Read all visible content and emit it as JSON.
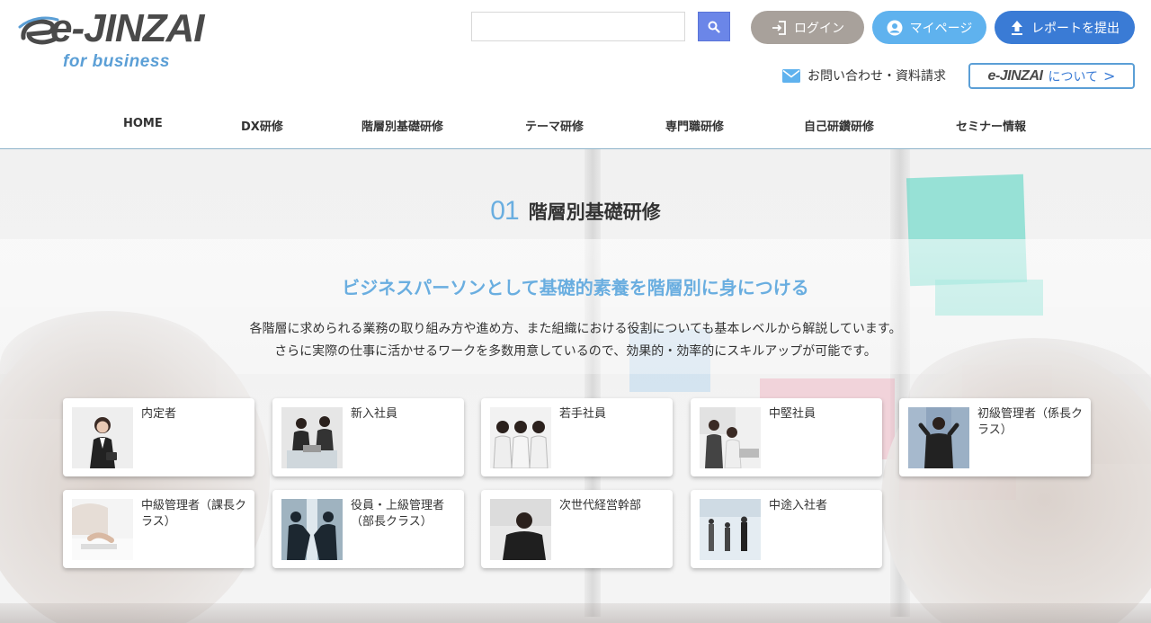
{
  "header": {
    "logo_main": "e-JINZAI",
    "logo_sub": "for business",
    "search": {
      "placeholder": "",
      "value": ""
    },
    "login_label": "ログイン",
    "mypage_label": "マイページ",
    "report_label": "レポートを提出",
    "contact_label": "お問い合わせ・資料請求",
    "about": {
      "logo": "e-JINZAI",
      "label": "について",
      "chevron": ">"
    }
  },
  "nav": {
    "items": [
      {
        "label": "HOME"
      },
      {
        "label": "DX研修"
      },
      {
        "label": "階層別基礎研修"
      },
      {
        "label": "テーマ研修"
      },
      {
        "label": "専門職研修"
      },
      {
        "label": "自己研鑽研修"
      },
      {
        "label": "セミナー情報"
      }
    ]
  },
  "section": {
    "number": "01",
    "title": "階層別基礎研修",
    "lead": "ビジネスパーソンとして基礎的素養を階層別に身につける",
    "desc_line1": "各階層に求められる業務の取り組み方や進め方、また組織における役割についても基本レベルから解説しています。",
    "desc_line2": "さらに実際の仕事に活かせるワークを多数用意しているので、効果的・効率的にスキルアップが可能です。"
  },
  "cards": [
    {
      "label": "内定者"
    },
    {
      "label": "新入社員"
    },
    {
      "label": "若手社員"
    },
    {
      "label": "中堅社員"
    },
    {
      "label": "初級管理者（係長クラス）"
    },
    {
      "label": "中級管理者（課長クラス）"
    },
    {
      "label": "役員・上級管理者（部長クラス）"
    },
    {
      "label": "次世代経営幹部"
    },
    {
      "label": "中途入社者"
    }
  ],
  "colors": {
    "accent_blue": "#6aaee0",
    "login_bg": "#a8a19b",
    "mypage_bg": "#5fb2ee",
    "report_bg": "#3a7bd5",
    "search_btn": "#6b86e8"
  }
}
